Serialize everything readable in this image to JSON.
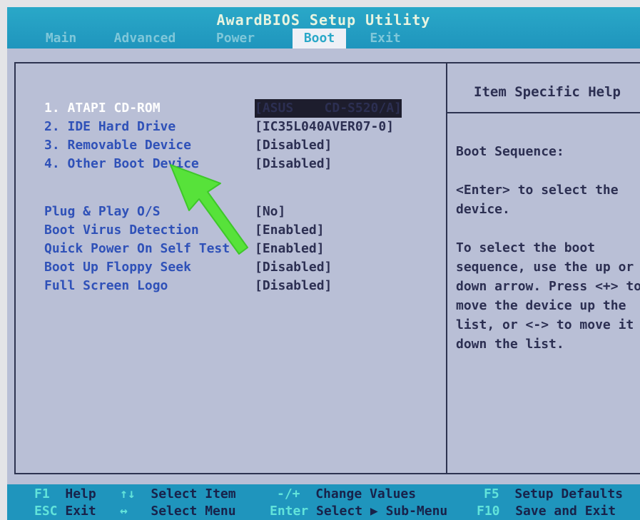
{
  "app_title": "AwardBIOS Setup Utility",
  "menu": {
    "tabs": [
      {
        "label": "Main"
      },
      {
        "label": "Advanced"
      },
      {
        "label": "Power"
      },
      {
        "label": "Boot"
      },
      {
        "label": "Exit"
      }
    ],
    "active": "Boot"
  },
  "boot_items": [
    {
      "label": "1. ATAPI CD-ROM",
      "value": "[ASUS    CD-S520/A]",
      "selected": true
    },
    {
      "label": "2. IDE Hard Drive",
      "value": "[IC35L040AVER07-0]"
    },
    {
      "label": "3. Removable Device",
      "value": "[Disabled]"
    },
    {
      "label": "4. Other Boot Device",
      "value": "[Disabled]"
    }
  ],
  "settings": [
    {
      "label": "Plug & Play O/S",
      "value": "[No]"
    },
    {
      "label": "Boot Virus Detection",
      "value": "[Enabled]"
    },
    {
      "label": "Quick Power On Self Test",
      "value": "[Enabled]"
    },
    {
      "label": "Boot Up Floppy Seek",
      "value": "[Disabled]"
    },
    {
      "label": "Full Screen Logo",
      "value": "[Disabled]"
    }
  ],
  "help": {
    "title": "Item Specific Help",
    "text": "Boot Sequence:\n\n<Enter> to select the device.\n\nTo select the boot sequence, use the up or down arrow. Press <+> to move the device up the list, or <-> to move it down the list."
  },
  "footer": [
    {
      "key": "F1",
      "desc": "Help"
    },
    {
      "key": "↑↓",
      "desc": "Select Item"
    },
    {
      "key": "-/+",
      "desc": "Change Values"
    },
    {
      "key": "F5",
      "desc": "Setup Defaults"
    },
    {
      "key": "ESC",
      "desc": "Exit"
    },
    {
      "key": "↔",
      "desc": "Select Menu"
    },
    {
      "key": "Enter",
      "desc": "Select ▶ Sub-Menu"
    },
    {
      "key": "F10",
      "desc": "Save and Exit"
    }
  ],
  "colors": {
    "background": "#b9bfd6",
    "header": "#2aa8c8",
    "label": "#2f51b8",
    "value": "#2c2f52",
    "annotation_arrow": "#57e23a"
  }
}
